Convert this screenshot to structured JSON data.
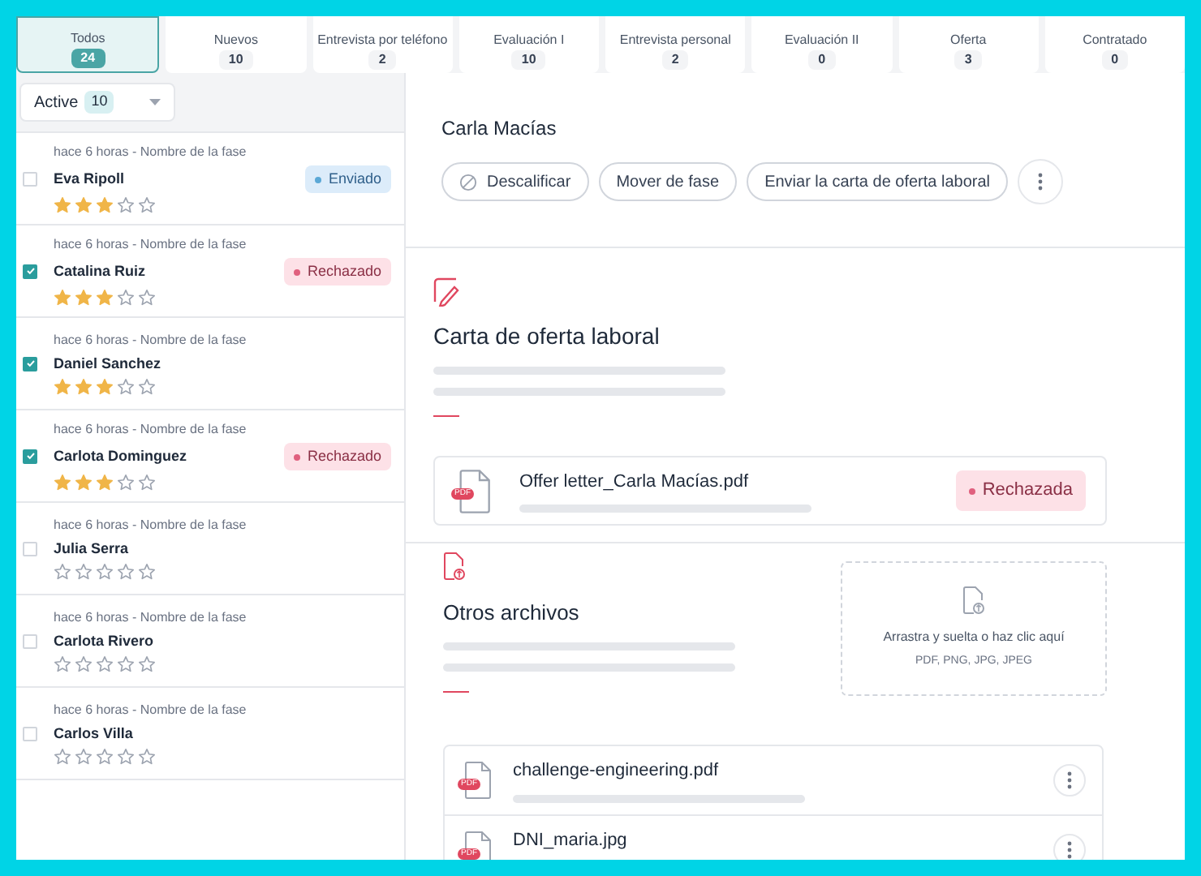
{
  "stages": [
    {
      "label": "Todos",
      "count": "24",
      "selected": true
    },
    {
      "label": "Nuevos",
      "count": "10",
      "selected": false
    },
    {
      "label": "Entrevista por teléfono",
      "count": "2",
      "selected": false
    },
    {
      "label": "Evaluación I",
      "count": "10",
      "selected": false
    },
    {
      "label": "Entrevista personal",
      "count": "2",
      "selected": false
    },
    {
      "label": "Evaluación II",
      "count": "0",
      "selected": false
    },
    {
      "label": "Oferta",
      "count": "3",
      "selected": false
    },
    {
      "label": "Contratado",
      "count": "0",
      "selected": false
    }
  ],
  "filter": {
    "value": "Active",
    "count": "10"
  },
  "candidates": [
    {
      "time": "hace 6 horas - Nombre de la fase",
      "name": "Eva Ripoll",
      "checked": false,
      "stars": 3,
      "status": {
        "label": "Enviado",
        "kind": "sent",
        "color": "#5ba8d6"
      }
    },
    {
      "time": "hace 6 horas - Nombre de la fase",
      "name": "Catalina Ruiz",
      "checked": true,
      "stars": 3,
      "status": {
        "label": "Rechazado",
        "kind": "rejected",
        "color": "#e0607e"
      }
    },
    {
      "time": "hace 6 horas - Nombre de la fase",
      "name": "Daniel Sanchez",
      "checked": true,
      "stars": 3
    },
    {
      "time": "hace 6 horas - Nombre de la fase",
      "name": "Carlota Dominguez",
      "checked": true,
      "stars": 3,
      "status": {
        "label": "Rechazado",
        "kind": "rejected",
        "color": "#e0607e"
      }
    },
    {
      "time": "hace 6 horas - Nombre de la fase",
      "name": "Julia Serra",
      "checked": false,
      "stars": 0
    },
    {
      "time": "hace 6 horas - Nombre de la fase",
      "name": "Carlota Rivero",
      "checked": false,
      "stars": 0
    },
    {
      "time": "hace 6 horas - Nombre de la fase",
      "name": "Carlos Villa",
      "checked": false,
      "stars": 0
    }
  ],
  "detail": {
    "name": "Carla Macías",
    "actions": [
      {
        "label": "Descalificar",
        "kind": "disqualify"
      },
      {
        "label": "Mover de fase",
        "kind": "plain"
      },
      {
        "label": "Enviar la carta de oferta laboral",
        "kind": "plain"
      }
    ],
    "offer": {
      "title": "Carta de oferta laboral",
      "file": {
        "tag": "PDF",
        "name": "Offer letter_Carla Macías.pdf",
        "status": {
          "label": "Rechazada",
          "kind": "rejected",
          "color": "#e0607e"
        }
      }
    },
    "other": {
      "title": "Otros archivos",
      "dropzone": {
        "text": "Arrastra y suelta o haz clic aquí",
        "formats": "PDF, PNG, JPG, JPEG"
      },
      "files": [
        {
          "tag": "PDF",
          "name": "challenge-engineering.pdf"
        },
        {
          "tag": "PDF",
          "name": "DNI_maria.jpg"
        }
      ]
    }
  }
}
